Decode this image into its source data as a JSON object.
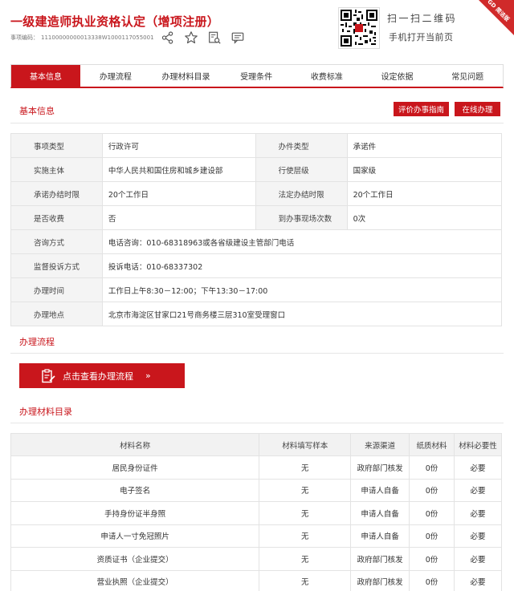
{
  "header": {
    "title": "一级建造师执业资格认定（增项注册）",
    "code_label": "事项编码：",
    "code_value": "11100000000013338W1000117055001",
    "scan_title": "扫一扫二维码",
    "scan_subtitle": "手机打开当前页",
    "badge": "GD 简洁版",
    "icons": [
      "share-icon",
      "star-icon",
      "search-doc-icon",
      "comment-icon"
    ]
  },
  "tabs": [
    {
      "label": "基本信息",
      "active": true
    },
    {
      "label": "办理流程",
      "active": false
    },
    {
      "label": "办理材料目录",
      "active": false
    },
    {
      "label": "受理条件",
      "active": false
    },
    {
      "label": "收费标准",
      "active": false
    },
    {
      "label": "设定依据",
      "active": false
    },
    {
      "label": "常见问题",
      "active": false
    }
  ],
  "basic": {
    "section_title": "基本信息",
    "btn_evaluate": "评价办事指南",
    "btn_online": "在线办理",
    "rows": [
      {
        "l1": "事项类型",
        "v1": "行政许可",
        "l2": "办件类型",
        "v2": "承诺件"
      },
      {
        "l1": "实施主体",
        "v1": "中华人民共和国住房和城乡建设部",
        "l2": "行使层级",
        "v2": "国家级"
      },
      {
        "l1": "承诺办结时限",
        "v1": "20个工作日",
        "l2": "法定办结时限",
        "v2": "20个工作日"
      },
      {
        "l1": "是否收费",
        "v1": "否",
        "l2": "到办事现场次数",
        "v2": "0次"
      }
    ],
    "wide_rows": [
      {
        "label": "咨询方式",
        "value": "电话咨询：010-68318963或各省级建设主管部门电话"
      },
      {
        "label": "监督投诉方式",
        "value": "投诉电话：010-68337302"
      },
      {
        "label": "办理时间",
        "value": "工作日上午8:30－12:00；下午13:30－17:00"
      },
      {
        "label": "办理地点",
        "value": "北京市海淀区甘家口21号商务楼三层310室受理窗口"
      }
    ]
  },
  "process": {
    "section_title": "办理流程",
    "button_label": "点击查看办理流程",
    "button_arrow": "»"
  },
  "materials": {
    "section_title": "办理材料目录",
    "headers": [
      "材料名称",
      "材料填写样本",
      "来源渠道",
      "纸质材料",
      "材料必要性"
    ],
    "rows": [
      [
        "居民身份证件",
        "无",
        "政府部门核发",
        "0份",
        "必要"
      ],
      [
        "电子签名",
        "无",
        "申请人自备",
        "0份",
        "必要"
      ],
      [
        "手持身份证半身照",
        "无",
        "申请人自备",
        "0份",
        "必要"
      ],
      [
        "申请人一寸免冠照片",
        "无",
        "申请人自备",
        "0份",
        "必要"
      ],
      [
        "资质证书（企业提交）",
        "无",
        "政府部门核发",
        "0份",
        "必要"
      ],
      [
        "营业执照（企业提交）",
        "无",
        "政府部门核发",
        "0份",
        "必要"
      ]
    ]
  },
  "colors": {
    "accent": "#c9161c",
    "label_bg": "#f4f4f4",
    "border": "#e3e3e3"
  }
}
